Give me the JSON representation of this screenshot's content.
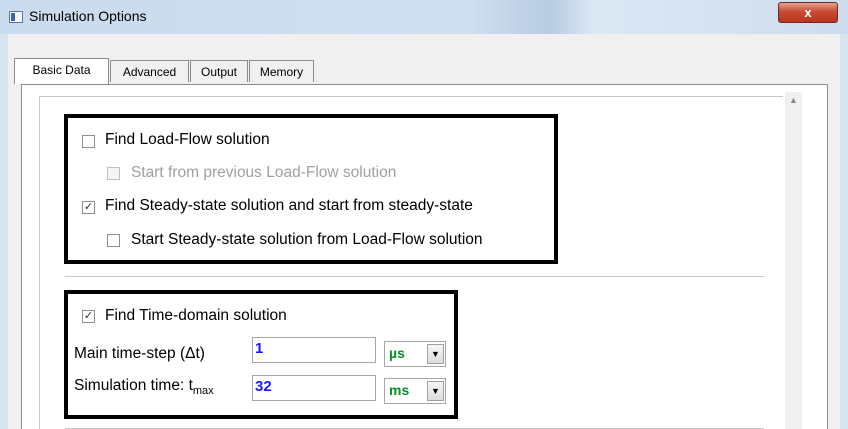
{
  "window": {
    "title": "Simulation Options",
    "close_glyph": "x"
  },
  "tabs": [
    {
      "label": "Basic Data",
      "active": true
    },
    {
      "label": "Advanced",
      "active": false
    },
    {
      "label": "Output",
      "active": false
    },
    {
      "label": "Memory",
      "active": false
    }
  ],
  "group1": {
    "find_load_flow": {
      "label": "Find Load-Flow solution",
      "checked": false,
      "enabled": true
    },
    "start_previous_lf": {
      "label": "Start from previous Load-Flow solution",
      "checked": false,
      "enabled": false
    },
    "find_steady_state": {
      "label": "Find Steady-state solution and start from steady-state",
      "checked": true,
      "enabled": true
    },
    "steady_from_lf": {
      "label": "Start Steady-state solution from Load-Flow solution",
      "checked": false,
      "enabled": true
    }
  },
  "group2": {
    "find_time_domain": {
      "label": "Find Time-domain solution",
      "checked": true
    },
    "timestep": {
      "label": "Main time-step (Δt)",
      "value": "1",
      "unit": "µs"
    },
    "simtime": {
      "label_prefix": "Simulation time: t",
      "label_sub": "max",
      "value": "32",
      "unit": "ms"
    }
  },
  "glyphs": {
    "check": "✓",
    "dropdown": "▼",
    "scroll_up": "▲"
  },
  "colors": {
    "input_value": "#1a1aff",
    "unit_value": "#0a8c2a"
  }
}
